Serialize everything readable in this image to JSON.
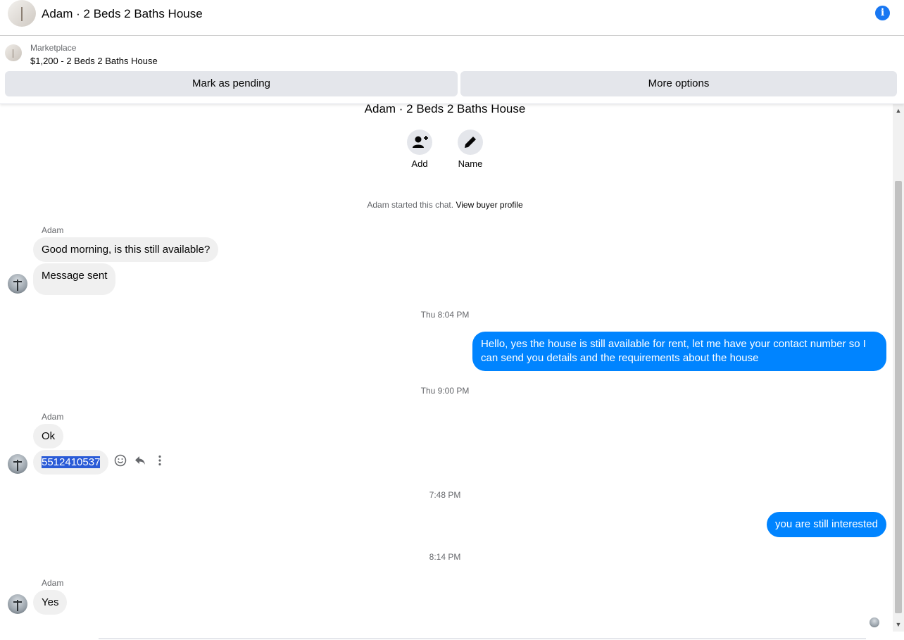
{
  "header": {
    "title": "Adam · 2 Beds 2 Baths House",
    "info_icon": "info-icon"
  },
  "listing": {
    "label": "Marketplace",
    "price_title": "$1,200 - 2 Beds 2 Baths House",
    "mark_pending": "Mark as pending",
    "more_options": "More options"
  },
  "conversation": {
    "title": "Adam · 2 Beds 2 Baths House",
    "actions": {
      "add_label": "Add",
      "name_label": "Name"
    },
    "started_text": "Adam started this chat.",
    "view_profile": "View buyer profile"
  },
  "messages": {
    "g1_sender": "Adam",
    "g1_msg1": "Good morning, is this still available?",
    "g1_msg2": "Message sent",
    "time1": "Thu 8:04 PM",
    "out1_line1": "Hello, yes the house is still available for rent, let me have your contact number so I",
    "out1_line2": "can send you details and the requirements about the house",
    "time2": "Thu 9:00 PM",
    "g2_sender": "Adam",
    "g2_msg1": "Ok",
    "g2_msg2": "5512410537",
    "time3": "7:48 PM",
    "out2": "you are still interested",
    "time4": "8:14 PM",
    "g3_sender": "Adam",
    "g3_msg1": "Yes"
  },
  "colors": {
    "accent": "#0084ff",
    "bubble_in": "#f0f0f0",
    "button_bg": "#e4e6eb",
    "selection": "#2a5bd7"
  },
  "icons": [
    "info-icon",
    "add-person-icon",
    "pencil-icon",
    "emoji-icon",
    "reply-icon",
    "more-vertical-icon"
  ]
}
